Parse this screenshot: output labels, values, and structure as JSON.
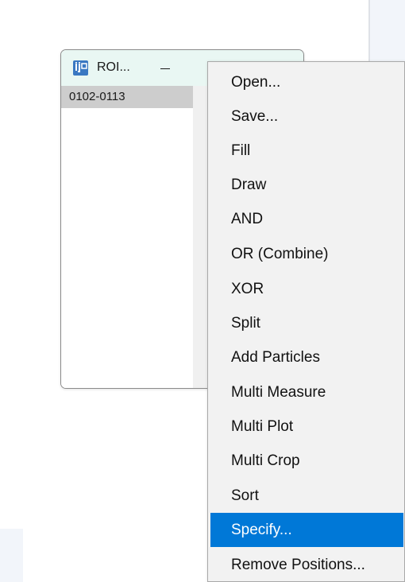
{
  "roi_manager": {
    "title": "ROI...",
    "list_items": [
      "0102-0113"
    ]
  },
  "context_menu": {
    "items": [
      {
        "label": "Open..."
      },
      {
        "label": "Save..."
      },
      {
        "label": "Fill"
      },
      {
        "label": "Draw"
      },
      {
        "label": "AND"
      },
      {
        "label": "OR (Combine)"
      },
      {
        "label": "XOR"
      },
      {
        "label": "Split"
      },
      {
        "label": "Add Particles"
      },
      {
        "label": "Multi Measure"
      },
      {
        "label": "Multi Plot"
      },
      {
        "label": "Multi Crop"
      },
      {
        "label": "Sort"
      },
      {
        "label": "Specify..."
      },
      {
        "label": "Remove Positions..."
      }
    ],
    "selected_label": "Specify...",
    "highlight_color": "#0078d7"
  },
  "icons": {
    "app_icon": "imagej-app-icon",
    "minimize": "minimize-icon"
  }
}
